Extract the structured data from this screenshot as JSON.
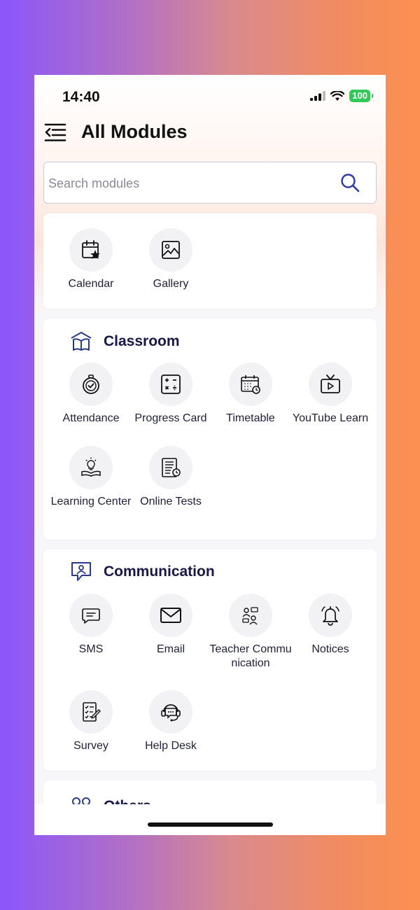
{
  "status_bar": {
    "time": "14:40",
    "battery": "100"
  },
  "header": {
    "title": "All Modules"
  },
  "search": {
    "placeholder": "Search modules",
    "value": ""
  },
  "quick": {
    "items": [
      {
        "label": "Calendar",
        "icon": "calendar-star-icon"
      },
      {
        "label": "Gallery",
        "icon": "gallery-icon"
      }
    ]
  },
  "classroom": {
    "title": "Classroom",
    "icon": "classroom-icon",
    "items": [
      {
        "label": "Attendance",
        "icon": "attendance-icon"
      },
      {
        "label": "Progress Card",
        "icon": "progress-card-icon"
      },
      {
        "label": "Timetable",
        "icon": "timetable-icon"
      },
      {
        "label": "YouTube Learn",
        "icon": "youtube-learn-icon"
      },
      {
        "label": "Learning Center",
        "icon": "learning-center-icon"
      },
      {
        "label": "Online Tests",
        "icon": "online-tests-icon"
      }
    ]
  },
  "communication": {
    "title": "Communication",
    "icon": "communication-icon",
    "items": [
      {
        "label": "SMS",
        "icon": "sms-icon"
      },
      {
        "label": "Email",
        "icon": "email-icon"
      },
      {
        "label": "Teacher Communication",
        "icon": "teacher-communication-icon"
      },
      {
        "label": "Notices",
        "icon": "notices-bell-icon"
      },
      {
        "label": "Survey",
        "icon": "survey-icon"
      },
      {
        "label": "Help Desk",
        "icon": "help-desk-icon"
      }
    ]
  },
  "others": {
    "title": "Others",
    "icon": "others-icon"
  },
  "colors": {
    "title": "#181848",
    "accent": "#3b3bb0",
    "battery": "#34c759"
  }
}
